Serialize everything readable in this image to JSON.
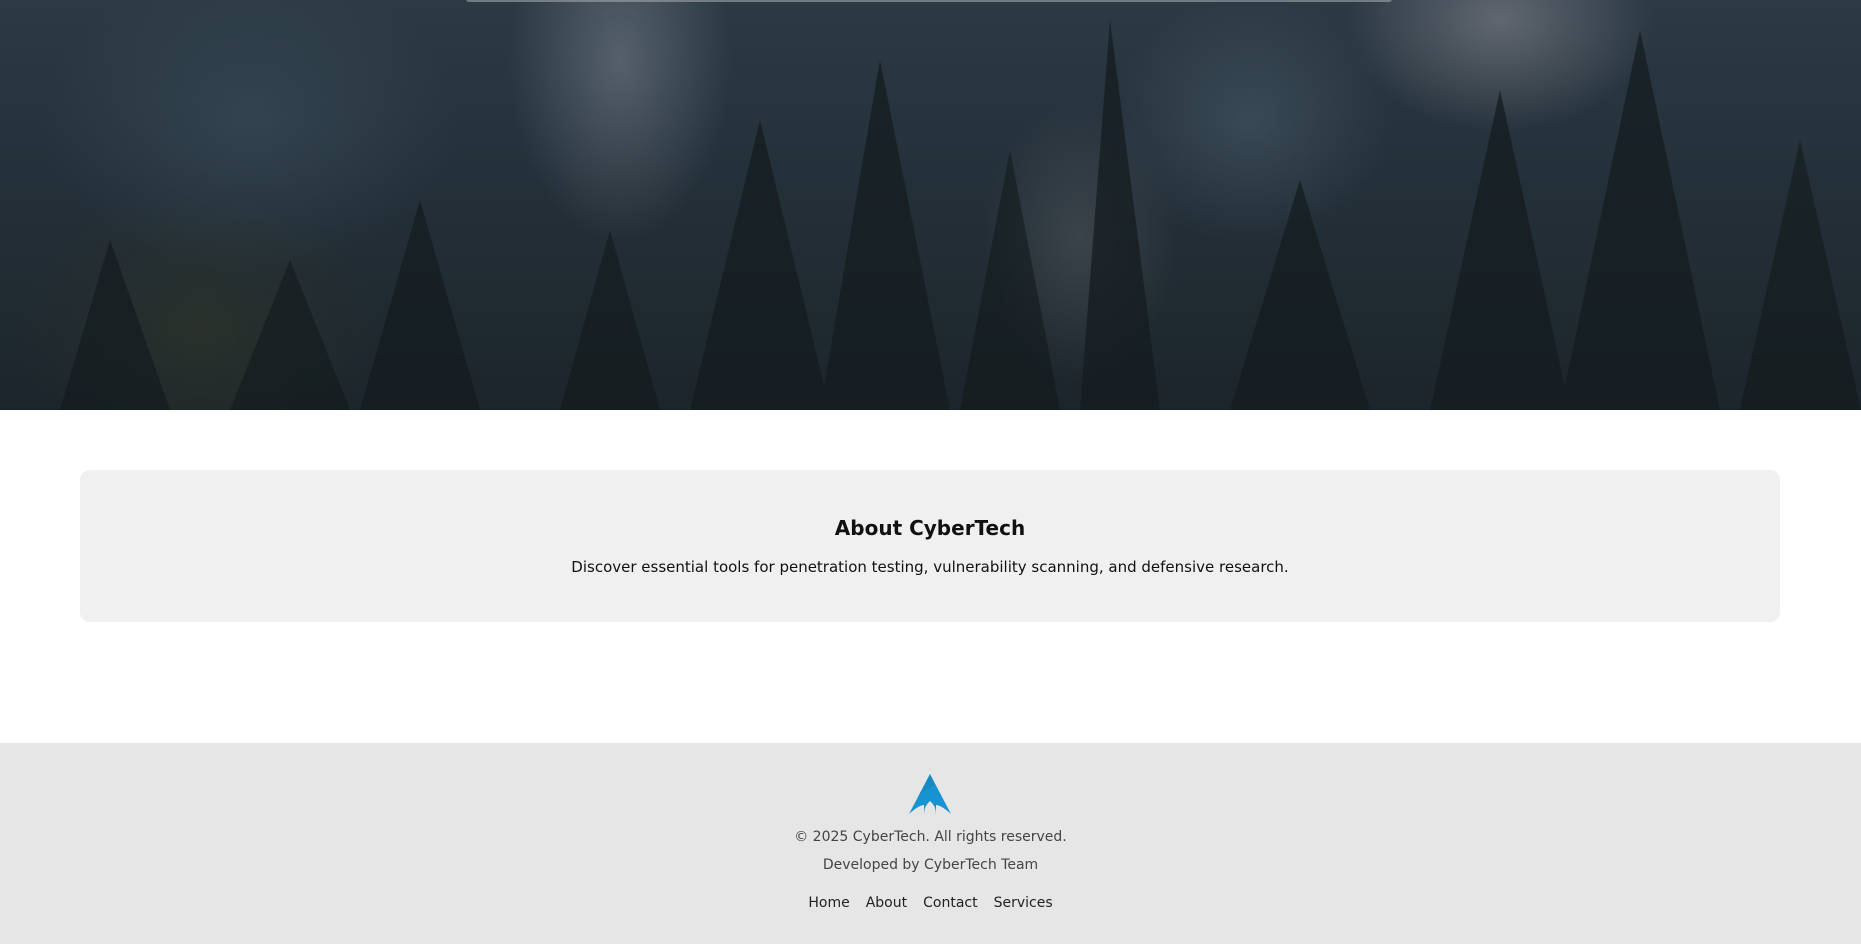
{
  "about": {
    "title": "About CyberTech",
    "description": "Discover essential tools for penetration testing, vulnerability scanning, and defensive research."
  },
  "footer": {
    "logo_icon": "arch-linux-logo-icon",
    "logo_color": "#1793d1",
    "copyright": "© 2025 CyberTech. All rights reserved.",
    "developer": "Developed by CyberTech Team",
    "links": [
      "Home",
      "About",
      "Contact",
      "Services"
    ]
  },
  "hero": {
    "image": "misty-forest-background"
  }
}
